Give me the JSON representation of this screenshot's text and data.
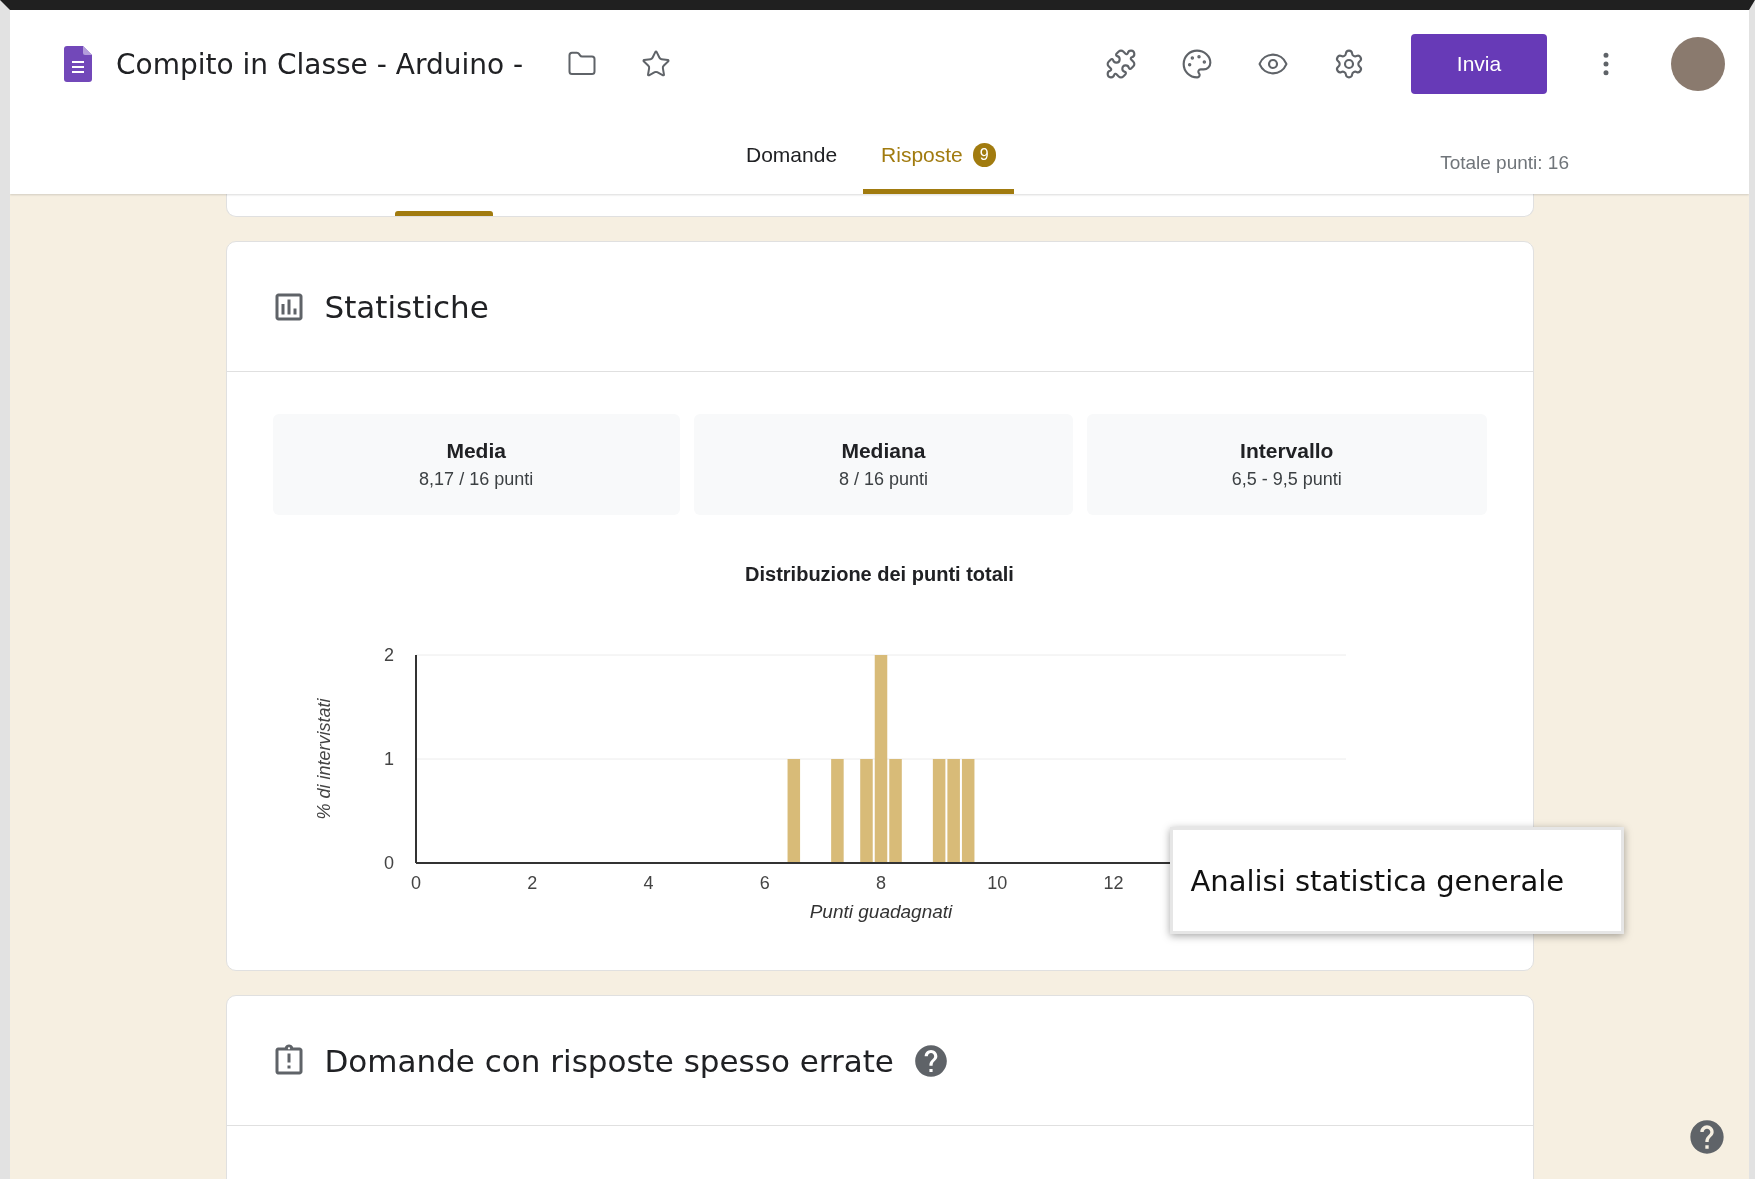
{
  "header": {
    "title": "Compito in Classe - Arduino -",
    "primary_button": "Invia"
  },
  "tabs": [
    {
      "label": "Domande",
      "selected": false
    },
    {
      "label": "Risposte",
      "selected": true,
      "badge": "9"
    }
  ],
  "total_points": "Totale punti: 16",
  "statistics": {
    "title": "Statistiche",
    "summary": [
      {
        "label": "Media",
        "value": "8,17 / 16 punti"
      },
      {
        "label": "Mediana",
        "value": "8 / 16 punti"
      },
      {
        "label": "Intervallo",
        "value": "6,5 - 9,5 punti"
      }
    ],
    "chart_data": {
      "type": "bar",
      "title": "Distribuzione dei punti totali",
      "xlabel": "Punti guadagnati",
      "ylabel": "% di intervistati",
      "x": [
        6.5,
        7.25,
        7.75,
        8,
        8.25,
        9,
        9.25,
        9.5
      ],
      "series": [
        {
          "color": "#d8bb78",
          "values": [
            1,
            1,
            1,
            2,
            1,
            1,
            1,
            1
          ]
        }
      ],
      "xlim": [
        0,
        16
      ],
      "ylim": [
        0,
        2
      ],
      "xticks": [
        0,
        2,
        4,
        6,
        8,
        10,
        12
      ],
      "yticks": [
        0,
        1,
        2
      ]
    },
    "callout": "Analisi statistica generale"
  },
  "frequent_errors": {
    "title": "Domande con risposte spesso errate"
  }
}
